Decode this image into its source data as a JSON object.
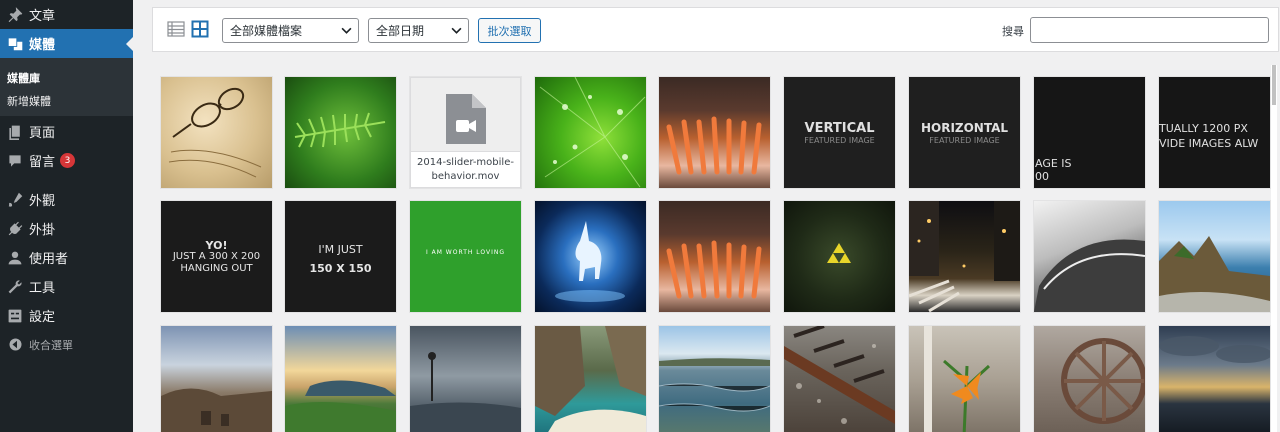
{
  "sidebar": {
    "menu": [
      {
        "label": "文章",
        "icon": "pin-icon"
      },
      {
        "label": "媒體",
        "icon": "media-icon",
        "active": true
      },
      {
        "label": "頁面",
        "icon": "pages-icon"
      },
      {
        "label": "留言",
        "icon": "comments-icon",
        "badge": "3"
      },
      {
        "label": "外觀",
        "icon": "appearance-icon"
      },
      {
        "label": "外掛",
        "icon": "plugins-icon"
      },
      {
        "label": "使用者",
        "icon": "users-icon"
      },
      {
        "label": "工具",
        "icon": "tools-icon"
      },
      {
        "label": "設定",
        "icon": "settings-icon"
      }
    ],
    "submenu": [
      {
        "label": "媒體庫",
        "current": true
      },
      {
        "label": "新增媒體"
      }
    ],
    "collapse_label": "收合選單"
  },
  "toolbar": {
    "filter_type": "全部媒體檔案",
    "filter_date": "全部日期",
    "bulk_select": "批次選取",
    "search_label": "搜尋",
    "search_value": ""
  },
  "colors": {
    "sidebar_bg": "#1d2327",
    "accent": "#2271b1",
    "badge": "#d63638"
  },
  "grid": {
    "tiles": [
      {
        "kind": "photo",
        "subject": "eyeglasses on letter"
      },
      {
        "kind": "photo",
        "subject": "green fern"
      },
      {
        "kind": "file",
        "name": "2014-slider-mobile-behavior.mov"
      },
      {
        "kind": "photo",
        "subject": "green leaf with water drops"
      },
      {
        "kind": "photo",
        "subject": "coral close-up"
      },
      {
        "kind": "placeholder",
        "title": "VERTICAL",
        "subtitle": "FEATURED IMAGE"
      },
      {
        "kind": "placeholder",
        "title": "HORIZONTAL",
        "subtitle": "FEATURED IMAGE"
      },
      {
        "kind": "placeholder",
        "line1": "AGE IS",
        "line2": "00"
      },
      {
        "kind": "placeholder",
        "line1": "TUALLY 1200 PX",
        "line2": "VIDE IMAGES ALW"
      },
      {
        "kind": "placeholder",
        "line1": "YO!",
        "line2": "JUST A 300 X 200",
        "line3": "HANGING OUT"
      },
      {
        "kind": "placeholder",
        "line1": "I'M JUST",
        "line2": "150 X 150"
      },
      {
        "kind": "placeholder",
        "line1": "I AM WORTH LOVING"
      },
      {
        "kind": "photo",
        "subject": "unicorn"
      },
      {
        "kind": "photo",
        "subject": "coral close-up"
      },
      {
        "kind": "photo",
        "subject": "triforce"
      },
      {
        "kind": "photo",
        "subject": "city street at night"
      },
      {
        "kind": "photo",
        "subject": "black and white boat"
      },
      {
        "kind": "photo",
        "subject": "coastal rocks"
      },
      {
        "kind": "photo",
        "subject": "rocky beach"
      },
      {
        "kind": "photo",
        "subject": "sunset over bay"
      },
      {
        "kind": "photo",
        "subject": "misty shore"
      },
      {
        "kind": "photo",
        "subject": "cove with turquoise water"
      },
      {
        "kind": "photo",
        "subject": "shallow sea"
      },
      {
        "kind": "photo",
        "subject": "railroad track"
      },
      {
        "kind": "photo",
        "subject": "orange lily"
      },
      {
        "kind": "photo",
        "subject": "old wagon wheel"
      },
      {
        "kind": "photo",
        "subject": "cloudy sky over water"
      }
    ]
  }
}
